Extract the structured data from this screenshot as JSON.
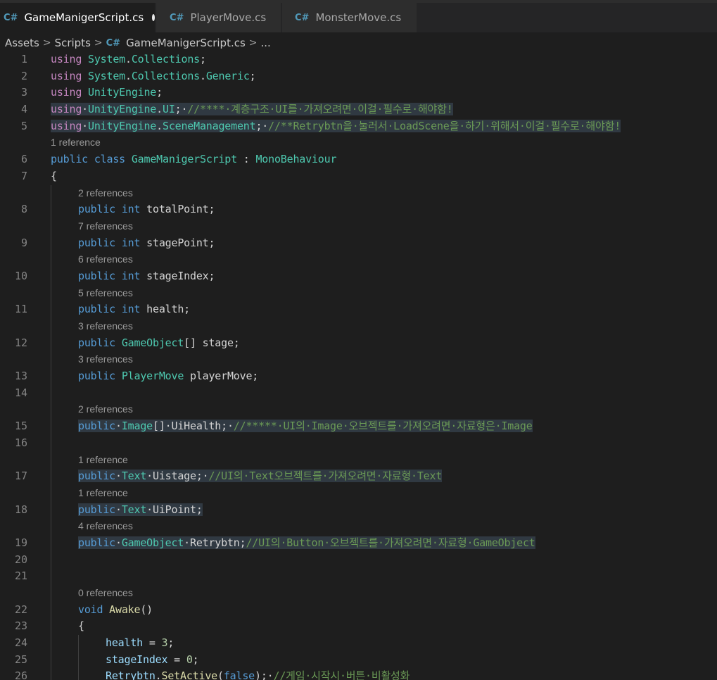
{
  "tabs": [
    {
      "label": "GameManigerScript.cs",
      "active": true,
      "dirty": true
    },
    {
      "label": "PlayerMove.cs",
      "active": false,
      "dirty": false
    },
    {
      "label": "MonsterMove.cs",
      "active": false,
      "dirty": false
    }
  ],
  "tab_icon": "C#",
  "breadcrumb": {
    "items": [
      "Assets",
      "Scripts",
      "GameManigerScript.cs",
      "..."
    ],
    "separator": ">"
  },
  "colors": {
    "keyword": "#569cd6",
    "using_keyword": "#c586c0",
    "type": "#4ec9b0",
    "comment": "#6a9955",
    "identifier": "#9cdcfe",
    "function": "#dcdcaa",
    "number": "#b5cea8",
    "line_number": "#858585"
  },
  "lines": [
    {
      "n": "1",
      "tokens": [
        [
          "kw2",
          "using"
        ],
        [
          "pl",
          " "
        ],
        [
          "ns",
          "System"
        ],
        [
          "pl",
          "."
        ],
        [
          "ns",
          "Collections"
        ],
        [
          "pl",
          ";"
        ]
      ]
    },
    {
      "n": "2",
      "tokens": [
        [
          "kw2",
          "using"
        ],
        [
          "pl",
          " "
        ],
        [
          "ns",
          "System"
        ],
        [
          "pl",
          "."
        ],
        [
          "ns",
          "Collections"
        ],
        [
          "pl",
          "."
        ],
        [
          "ns",
          "Generic"
        ],
        [
          "pl",
          ";"
        ]
      ]
    },
    {
      "n": "3",
      "tokens": [
        [
          "kw2",
          "using"
        ],
        [
          "pl",
          " "
        ],
        [
          "ns",
          "UnityEngine"
        ],
        [
          "pl",
          ";"
        ]
      ]
    },
    {
      "n": "4",
      "sel": true,
      "tokens": [
        [
          "kw2",
          "using"
        ],
        [
          "pl",
          "·"
        ],
        [
          "ns",
          "UnityEngine"
        ],
        [
          "pl",
          "."
        ],
        [
          "ns",
          "UI"
        ],
        [
          "pl",
          ";·"
        ],
        [
          "cm",
          "//****·계층구조·UI를·가져오려면·이걸·필수로·해야함!"
        ]
      ]
    },
    {
      "n": "5",
      "sel": true,
      "tokens": [
        [
          "kw2",
          "using"
        ],
        [
          "pl",
          "·"
        ],
        [
          "ns",
          "UnityEngine"
        ],
        [
          "pl",
          "."
        ],
        [
          "ns",
          "SceneManagement"
        ],
        [
          "pl",
          ";·"
        ],
        [
          "cm",
          "//**Retrybtn을·눌러서·LoadScene을·하기·위해서·이걸·필수로·해야함!"
        ]
      ]
    },
    {
      "lens": "1 reference",
      "indent": 0
    },
    {
      "n": "6",
      "tokens": [
        [
          "kw",
          "public"
        ],
        [
          "pl",
          " "
        ],
        [
          "kw",
          "class"
        ],
        [
          "pl",
          " "
        ],
        [
          "ty",
          "GameManigerScript"
        ],
        [
          "pl",
          " : "
        ],
        [
          "ty",
          "MonoBehaviour"
        ]
      ]
    },
    {
      "n": "7",
      "tokens": [
        [
          "pl",
          "{"
        ]
      ]
    },
    {
      "lens": "2 references",
      "indent": 1
    },
    {
      "n": "8",
      "indent": 1,
      "tokens": [
        [
          "kw",
          "public"
        ],
        [
          "pl",
          " "
        ],
        [
          "kw",
          "int"
        ],
        [
          "pl",
          " totalPoint;"
        ]
      ]
    },
    {
      "lens": "7 references",
      "indent": 1
    },
    {
      "n": "9",
      "indent": 1,
      "tokens": [
        [
          "kw",
          "public"
        ],
        [
          "pl",
          " "
        ],
        [
          "kw",
          "int"
        ],
        [
          "pl",
          " stagePoint;"
        ]
      ]
    },
    {
      "lens": "6 references",
      "indent": 1
    },
    {
      "n": "10",
      "indent": 1,
      "tokens": [
        [
          "kw",
          "public"
        ],
        [
          "pl",
          " "
        ],
        [
          "kw",
          "int"
        ],
        [
          "pl",
          " stageIndex;"
        ]
      ]
    },
    {
      "lens": "5 references",
      "indent": 1
    },
    {
      "n": "11",
      "indent": 1,
      "tokens": [
        [
          "kw",
          "public"
        ],
        [
          "pl",
          " "
        ],
        [
          "kw",
          "int"
        ],
        [
          "pl",
          " health;"
        ]
      ]
    },
    {
      "lens": "3 references",
      "indent": 1
    },
    {
      "n": "12",
      "indent": 1,
      "tokens": [
        [
          "kw",
          "public"
        ],
        [
          "pl",
          " "
        ],
        [
          "ty",
          "GameObject"
        ],
        [
          "pl",
          "[] stage;"
        ]
      ]
    },
    {
      "lens": "3 references",
      "indent": 1
    },
    {
      "n": "13",
      "indent": 1,
      "tokens": [
        [
          "kw",
          "public"
        ],
        [
          "pl",
          " "
        ],
        [
          "ty",
          "PlayerMove"
        ],
        [
          "pl",
          " playerMove;"
        ]
      ]
    },
    {
      "n": "14",
      "indent": 1,
      "tokens": []
    },
    {
      "lens": "2 references",
      "indent": 1
    },
    {
      "n": "15",
      "indent": 1,
      "sel": true,
      "tokens": [
        [
          "kw",
          "public"
        ],
        [
          "pl",
          "·"
        ],
        [
          "ty",
          "Image"
        ],
        [
          "pl",
          "[]·UiHealth;·"
        ],
        [
          "cm",
          "//*****·UI의·Image·오브젝트를·가져오려면·자료형은·Image"
        ]
      ]
    },
    {
      "n": "16",
      "indent": 1,
      "tokens": []
    },
    {
      "lens": "1 reference",
      "indent": 1
    },
    {
      "n": "17",
      "indent": 1,
      "sel": true,
      "tokens": [
        [
          "kw",
          "public"
        ],
        [
          "pl",
          "·"
        ],
        [
          "ty",
          "Text"
        ],
        [
          "pl",
          "·Uistage;·"
        ],
        [
          "cm",
          "//UI의·Text오브젝트를·가져오려면·자료형·Text"
        ]
      ]
    },
    {
      "lens": "1 reference",
      "indent": 1
    },
    {
      "n": "18",
      "indent": 1,
      "sel": true,
      "tokens": [
        [
          "kw",
          "public"
        ],
        [
          "pl",
          "·"
        ],
        [
          "ty",
          "Text"
        ],
        [
          "pl",
          "·UiPoint;"
        ]
      ]
    },
    {
      "lens": "4 references",
      "indent": 1
    },
    {
      "n": "19",
      "indent": 1,
      "sel": true,
      "tokens": [
        [
          "kw",
          "public"
        ],
        [
          "pl",
          "·"
        ],
        [
          "ty",
          "GameObject"
        ],
        [
          "pl",
          "·Retrybtn;"
        ],
        [
          "cm",
          "//UI의·Button·오브젝트를·가져오려면·자료형·GameObject"
        ]
      ]
    },
    {
      "n": "20",
      "indent": 1,
      "tokens": []
    },
    {
      "n": "21",
      "indent": 1,
      "tokens": []
    },
    {
      "lens": "0 references",
      "indent": 1
    },
    {
      "n": "22",
      "indent": 1,
      "tokens": [
        [
          "kw",
          "void"
        ],
        [
          "pl",
          " "
        ],
        [
          "fn",
          "Awake"
        ],
        [
          "pl",
          "()"
        ]
      ]
    },
    {
      "n": "23",
      "indent": 1,
      "tokens": [
        [
          "pl",
          "{"
        ]
      ]
    },
    {
      "n": "24",
      "indent": 2,
      "tokens": [
        [
          "id",
          "health"
        ],
        [
          "pl",
          " = "
        ],
        [
          "num",
          "3"
        ],
        [
          "pl",
          ";"
        ]
      ]
    },
    {
      "n": "25",
      "indent": 2,
      "tokens": [
        [
          "id",
          "stageIndex"
        ],
        [
          "pl",
          " = "
        ],
        [
          "num",
          "0"
        ],
        [
          "pl",
          ";"
        ]
      ]
    },
    {
      "n": "26",
      "indent": 2,
      "tokens": [
        [
          "id",
          "Retrybtn"
        ],
        [
          "pl",
          "."
        ],
        [
          "fn",
          "SetActive"
        ],
        [
          "pl",
          "("
        ],
        [
          "kw",
          "false"
        ],
        [
          "pl",
          ");·"
        ],
        [
          "cm",
          "//게임·시작시·버튼·비활성화"
        ]
      ]
    }
  ]
}
